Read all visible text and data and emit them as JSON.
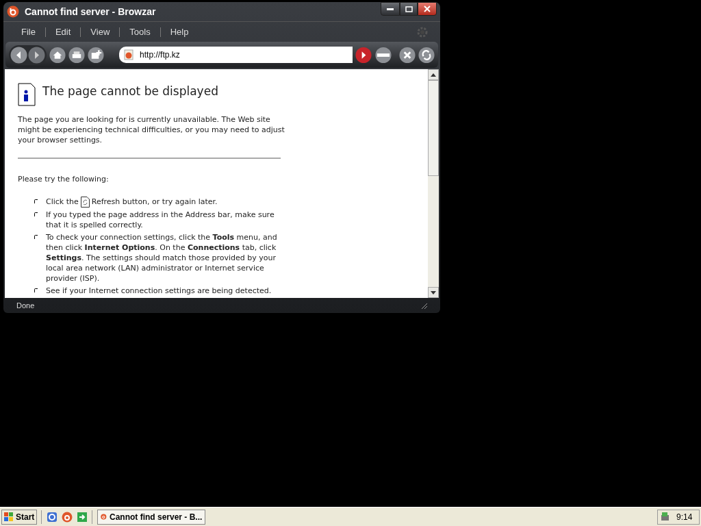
{
  "window": {
    "title": "Cannot find server - Browzar"
  },
  "menu": [
    "File",
    "Edit",
    "View",
    "Tools",
    "Help"
  ],
  "address": {
    "value": "http://ftp.kz"
  },
  "page": {
    "heading": "The page cannot be displayed",
    "intro": "The page you are looking for is currently unavailable. The Web site might be experiencing technical difficulties, or you may need to adjust your browser settings.",
    "try_label": "Please try the following:",
    "bullets": [
      {
        "kind": "refresh",
        "before": "Click the",
        "after": "Refresh button, or try again later."
      },
      {
        "kind": "text",
        "text": "If you typed the page address in the Address bar, make sure that it is spelled correctly."
      },
      {
        "kind": "text",
        "text": "To check your connection settings, click the **Tools** menu, and then click **Internet Options**. On the **Connections** tab, click **Settings**. The settings should match those provided by your local area network (LAN) administrator or Internet service provider (ISP)."
      },
      {
        "kind": "text",
        "text": "See if your Internet connection settings are being detected."
      }
    ]
  },
  "status_bar": {
    "text": "Done"
  },
  "taskbar": {
    "start": "Start",
    "task": "Cannot find server - B...",
    "clock": "9:14"
  }
}
